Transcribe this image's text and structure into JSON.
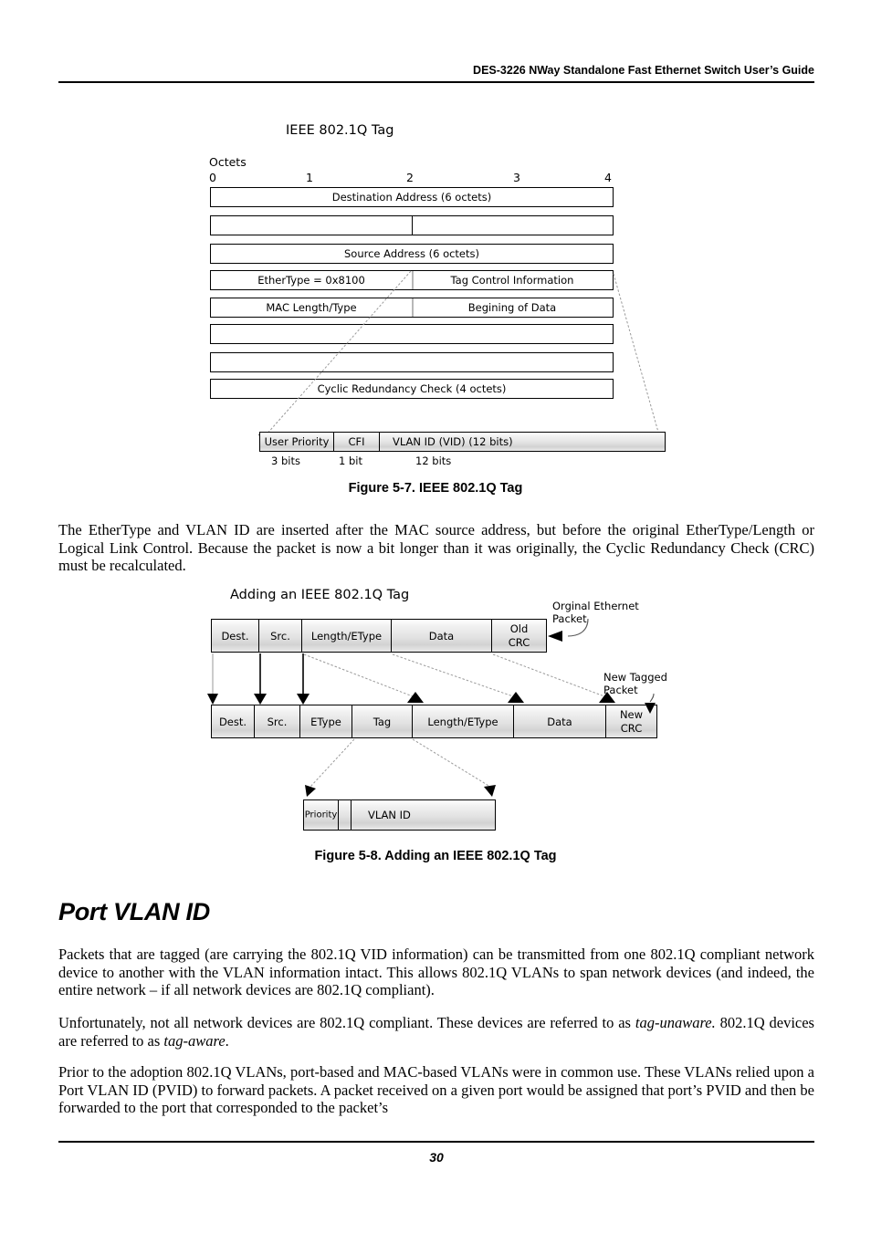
{
  "header": {
    "title": "DES-3226 NWay Standalone Fast Ethernet Switch User’s Guide"
  },
  "footer": {
    "page_number": "30"
  },
  "figure_5_7": {
    "diagram_title": "IEEE 802.1Q Tag",
    "octets_label": "Octets",
    "ruler": [
      "0",
      "1",
      "2",
      "3",
      "4"
    ],
    "rows": [
      {
        "id": "dest-addr",
        "label": "Destination Address (6 octets)",
        "split": false
      },
      {
        "id": "dest-src-split",
        "label": "",
        "split": true
      },
      {
        "id": "src-addr",
        "label": "Source Address (6 octets)",
        "split": false
      },
      {
        "id": "ethertype",
        "left": "EtherType = 0x8100",
        "right": "Tag Control Information",
        "split": true
      },
      {
        "id": "mac-length",
        "left": "MAC Length/Type",
        "right": "Begining of Data",
        "split": true
      },
      {
        "id": "blank-1",
        "label": "",
        "split": false
      },
      {
        "id": "blank-2",
        "label": "",
        "split": false
      },
      {
        "id": "crc",
        "label": "Cyclic Redundancy Check (4 octets)",
        "split": false
      }
    ],
    "tag_detail": {
      "cells": [
        {
          "label": "User Priority",
          "bits": "3 bits"
        },
        {
          "label": "CFI",
          "bits": "1 bit"
        },
        {
          "label": "VLAN ID (VID) (12 bits)",
          "bits": "12 bits"
        }
      ]
    },
    "caption": "Figure 5-7.  IEEE 802.1Q Tag"
  },
  "paragraph_1": "The EtherType and VLAN ID are inserted after the MAC source address, but before the original EtherType/Length or Logical Link Control. Because the packet is now a bit longer than it was originally, the Cyclic Redundancy Check (CRC) must be recalculated.",
  "figure_5_8": {
    "diagram_title": "Adding an IEEE 802.1Q Tag",
    "original_packet_label": "Orginal Ethernet\nPacket",
    "new_packet_label": "New Tagged\nPacket",
    "original_cells": [
      "Dest.",
      "Src.",
      "Length/EType",
      "Data",
      "Old\nCRC"
    ],
    "tagged_cells": [
      "Dest.",
      "Src.",
      "EType",
      "Tag",
      "Length/EType",
      "Data",
      "New\nCRC"
    ],
    "tag_detail_cells": [
      "Priority",
      "",
      "VLAN ID"
    ],
    "caption": "Figure 5-8.  Adding an IEEE 802.1Q Tag"
  },
  "section": {
    "heading": "Port VLAN ID"
  },
  "paragraph_2": "Packets that are tagged (are carrying the 802.1Q VID information) can be transmitted from one 802.1Q compliant network device to another with the VLAN information intact. This allows 802.1Q VLANs to span network devices (and indeed, the entire network – if all network devices are 802.1Q compliant).",
  "paragraph_3": {
    "part1": "Unfortunately, not all network devices are 802.1Q compliant. These devices are referred to as ",
    "em1": "tag-unaware.",
    "part2": "  802.1Q devices are referred to as ",
    "em2": "tag-aware",
    "part3": "."
  },
  "paragraph_4": "Prior to the adoption 802.1Q VLANs, port-based and MAC-based VLANs were in common use. These VLANs relied upon a Port VLAN ID (PVID) to forward packets. A packet received on a given port would be assigned that port’s PVID and then be forwarded to the port that corresponded to the packet’s"
}
